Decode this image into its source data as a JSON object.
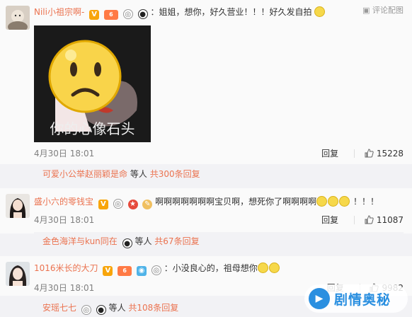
{
  "comments": [
    {
      "username": "Nili小祖宗啊-",
      "content": "：姐姐，想你，好久营业！！！好久发自拍",
      "sticker_caption": "你的心像石头",
      "date": "4月30日 18:01",
      "reply_label": "回复",
      "likes": "15228",
      "report_label": "评论配图",
      "subreply": {
        "names": "可爱小公举赵丽颖是命",
        "text": "等人",
        "more": "共300条回复"
      }
    },
    {
      "username": "盛小六的零钱宝",
      "content": "啊啊啊啊啊啊啊宝贝啊，想死你了啊啊啊啊",
      "content_tail": "！！！",
      "date": "4月30日 18:01",
      "reply_label": "回复",
      "likes": "11087",
      "subreply": {
        "names": "金色海洋与kun同在",
        "text": "等人",
        "more": "共67条回复"
      }
    },
    {
      "username": "1016米长的大刀",
      "content": "：小没良心的，祖母想你",
      "date": "4月30日 18:01",
      "reply_label": "回复",
      "likes": "9982",
      "subreply": {
        "names": "安瑶七七",
        "text": "等人",
        "more": "共108条回复"
      }
    }
  ],
  "watermark": {
    "text": "剧情奥秘"
  },
  "colors": {
    "accent": "#eb7350",
    "watermark_blue": "#2a8fe0"
  },
  "icons": [
    "verified-icon",
    "level-icon",
    "ring-icon",
    "panda-icon",
    "thumb-up-icon",
    "smile-emoji-icon",
    "camera-icon",
    "image-icon"
  ]
}
